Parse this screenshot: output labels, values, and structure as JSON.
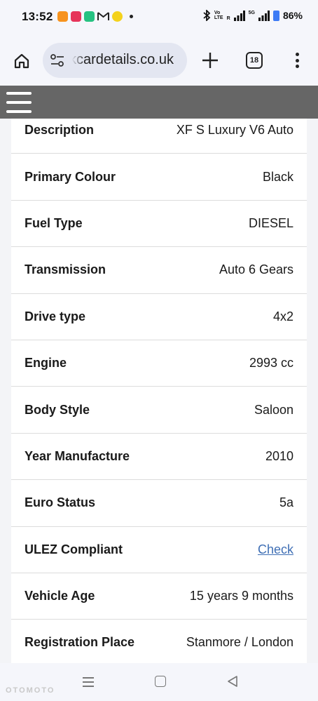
{
  "status_bar": {
    "time": "13:52",
    "volte_top": "Vo",
    "volte_bottom": "LTE",
    "roaming": "R",
    "network": "5G",
    "battery": "86%"
  },
  "browser": {
    "url_text": "kcardetails.co.uk",
    "tab_count": "18"
  },
  "details": [
    {
      "label": "Description",
      "value": "XF S Luxury V6 Auto"
    },
    {
      "label": "Primary Colour",
      "value": "Black"
    },
    {
      "label": "Fuel Type",
      "value": "DIESEL"
    },
    {
      "label": "Transmission",
      "value": "Auto 6 Gears"
    },
    {
      "label": "Drive type",
      "value": "4x2"
    },
    {
      "label": "Engine",
      "value": "2993 cc"
    },
    {
      "label": "Body Style",
      "value": "Saloon"
    },
    {
      "label": "Year Manufacture",
      "value": "2010"
    },
    {
      "label": "Euro Status",
      "value": "5a"
    },
    {
      "label": "ULEZ Compliant",
      "value": "Check"
    },
    {
      "label": "Vehicle Age",
      "value": "15 years 9 months"
    },
    {
      "label": "Registration Place",
      "value": "Stanmore / London"
    }
  ],
  "colors": {
    "site_header": "#666666",
    "link": "#3f6fb5",
    "browser_chrome": "#f5f6fb",
    "urlbar": "#e3e6f1"
  },
  "icons": [
    "home-icon",
    "site-settings-icon",
    "plus-icon",
    "tabs-icon",
    "more-vert-icon",
    "hamburger-menu-icon",
    "recents-icon",
    "home-nav-icon",
    "back-nav-icon"
  ],
  "watermark": "OTOMOTO"
}
